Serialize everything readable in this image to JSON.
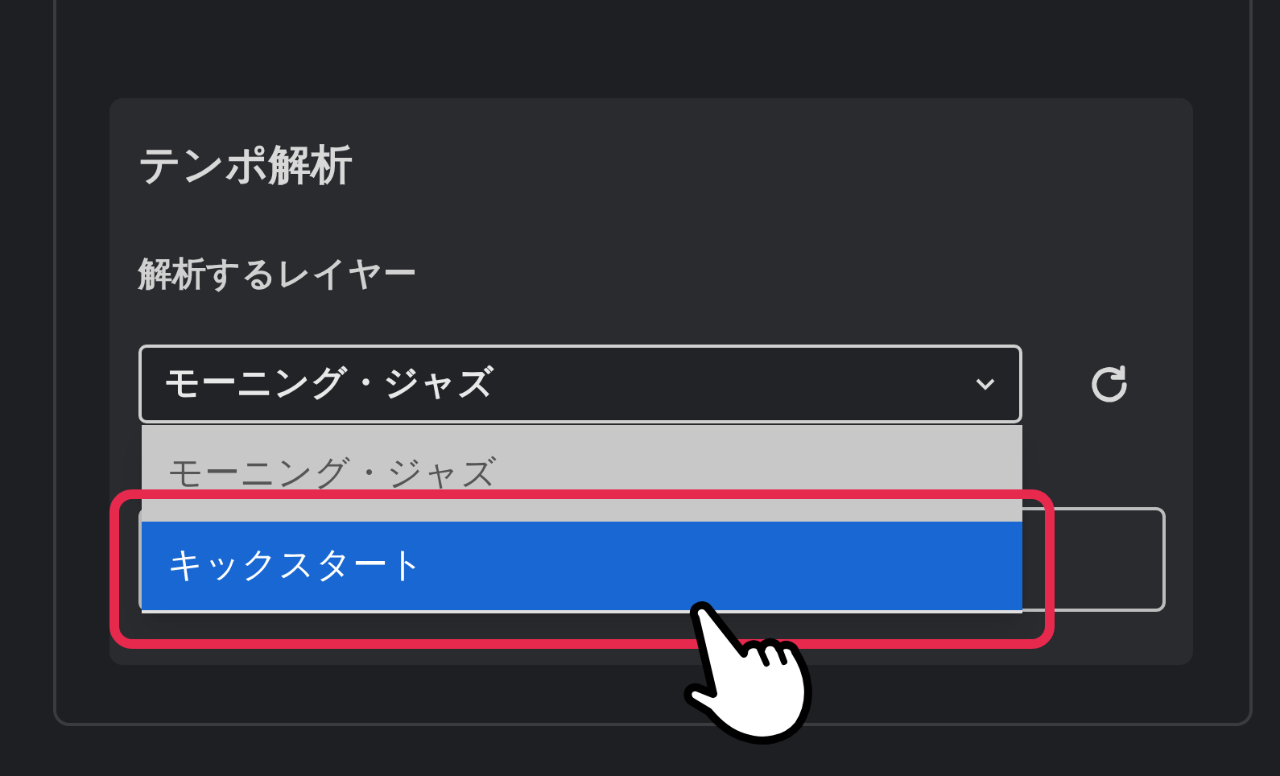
{
  "section": {
    "title": "テンポ解析",
    "label": "解析するレイヤー"
  },
  "layer_select": {
    "value": "モーニング・ジャズ",
    "expanded": true,
    "options": [
      {
        "label": "モーニング・ジャズ",
        "selected": true,
        "highlighted": false
      },
      {
        "label": "キックスタート",
        "selected": false,
        "highlighted": true
      }
    ]
  }
}
